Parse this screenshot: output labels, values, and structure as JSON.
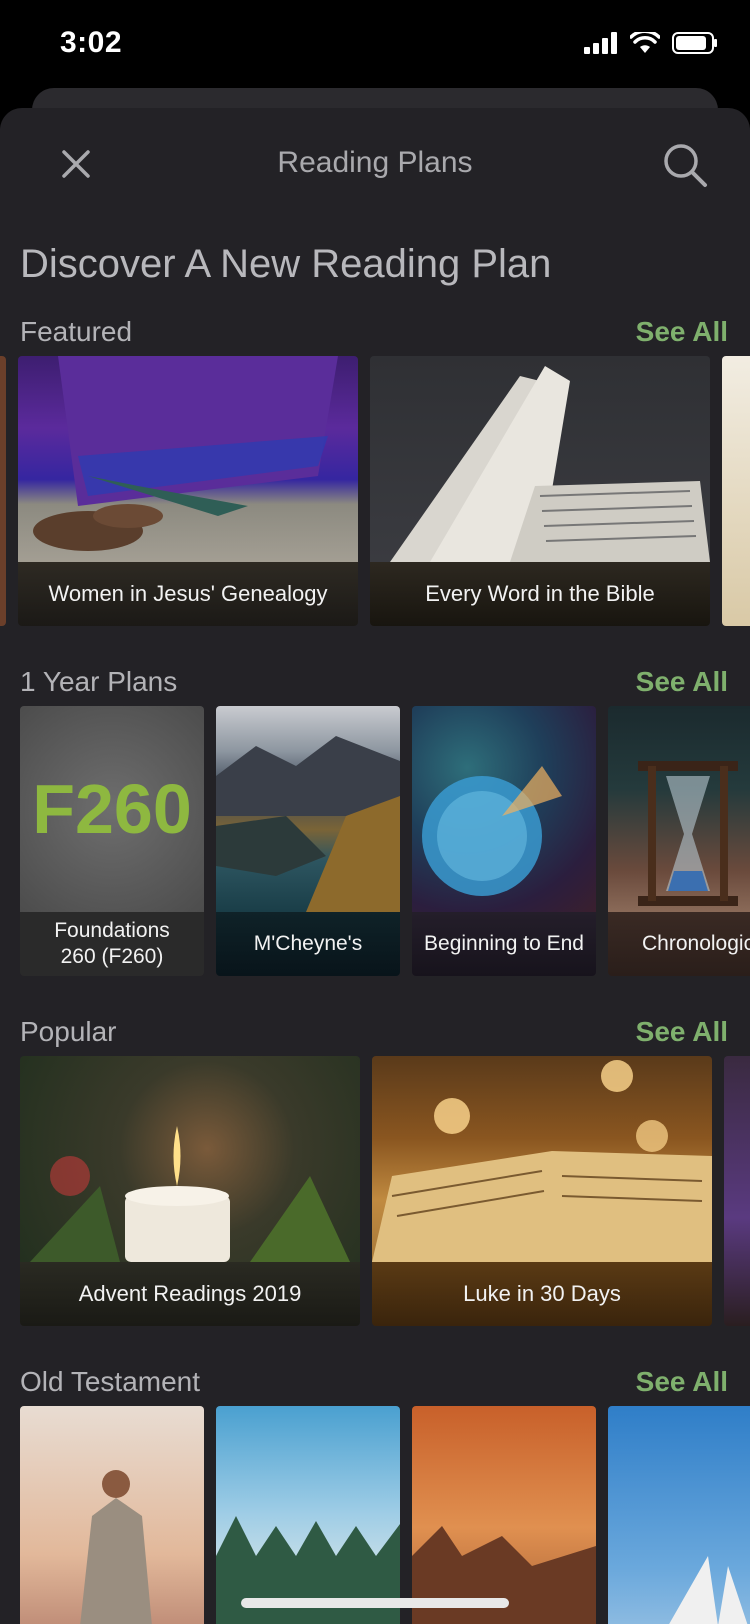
{
  "status": {
    "time": "3:02"
  },
  "nav": {
    "title": "Reading Plans"
  },
  "heading": "Discover A New Reading Plan",
  "sections": {
    "featured": {
      "label": "Featured",
      "see_all": "See All",
      "cards": [
        {
          "title": "Women in Jesus' Genealogy"
        },
        {
          "title": "Every Word in the Bible"
        }
      ]
    },
    "year": {
      "label": "1 Year Plans",
      "see_all": "See All",
      "cards": [
        {
          "title": "Foundations 260 (F260)",
          "art": "F260"
        },
        {
          "title": "M'Cheyne's"
        },
        {
          "title": "Beginning to End"
        },
        {
          "title": "Chronological"
        }
      ]
    },
    "popular": {
      "label": "Popular",
      "see_all": "See All",
      "cards": [
        {
          "title": "Advent Readings 2019"
        },
        {
          "title": "Luke in 30 Days"
        }
      ]
    },
    "old": {
      "label": "Old Testament",
      "see_all": "See All"
    }
  },
  "colors": {
    "accent": "#7fb06d",
    "background": "#232226"
  }
}
